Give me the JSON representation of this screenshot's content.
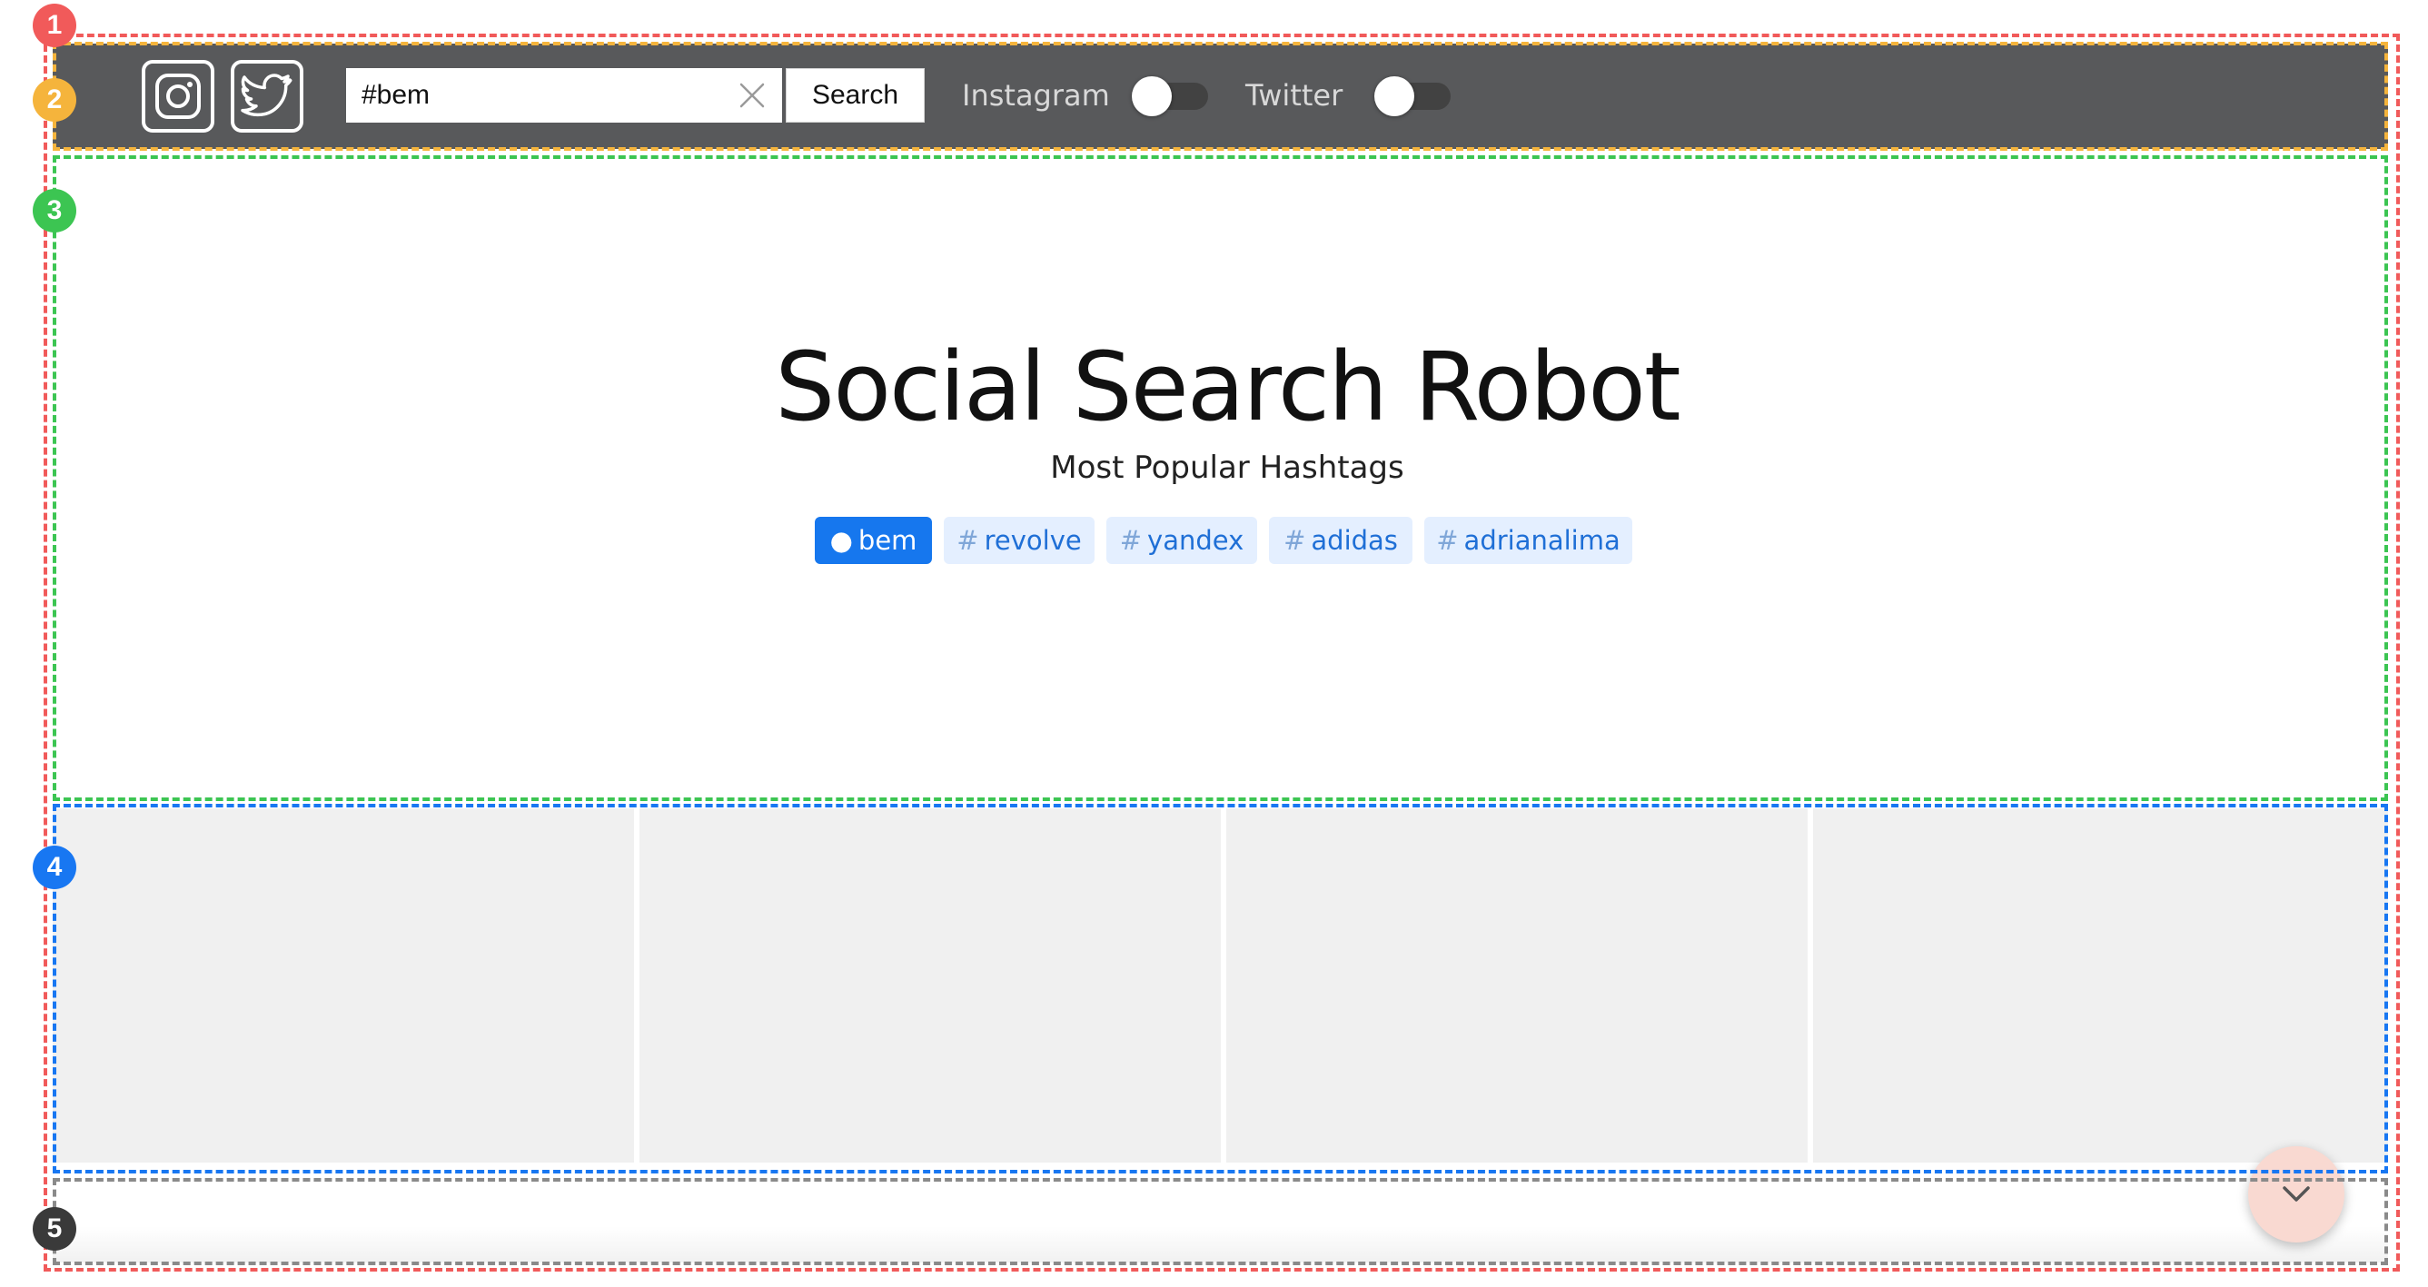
{
  "header": {
    "search": {
      "value": "#bem",
      "button_label": "Search"
    },
    "toggles": [
      {
        "label": "Instagram",
        "on": false
      },
      {
        "label": "Twitter",
        "on": false
      }
    ],
    "icons": [
      "instagram-icon",
      "twitter-icon",
      "close-icon"
    ]
  },
  "hero": {
    "title": "Social Search Robot",
    "subtitle": "Most Popular Hashtags",
    "hashtags": [
      {
        "label": "bem",
        "prefix": "●",
        "active": true
      },
      {
        "label": "revolve",
        "prefix": "#",
        "active": false
      },
      {
        "label": "yandex",
        "prefix": "#",
        "active": false
      },
      {
        "label": "adidas",
        "prefix": "#",
        "active": false
      },
      {
        "label": "adrianalima",
        "prefix": "#",
        "active": false
      }
    ]
  },
  "results": {
    "tile_count": 4
  },
  "footer": {
    "scroll_button_icon": "chevron-down-icon"
  },
  "annotations": {
    "badges": [
      "1",
      "2",
      "3",
      "4",
      "5"
    ],
    "colors": {
      "1": "#f15a5a",
      "2": "#f5b43c",
      "3": "#3cc552",
      "4": "#1877f2",
      "5": "#3a3a3a"
    }
  },
  "colors": {
    "header_bg": "#58595b",
    "tag_active_bg": "#1677ee",
    "tag_bg": "#e4efff",
    "tag_text": "#1f6fd6",
    "tile_bg": "#f0f0f0",
    "fab_bg": "#f9d9d1"
  }
}
